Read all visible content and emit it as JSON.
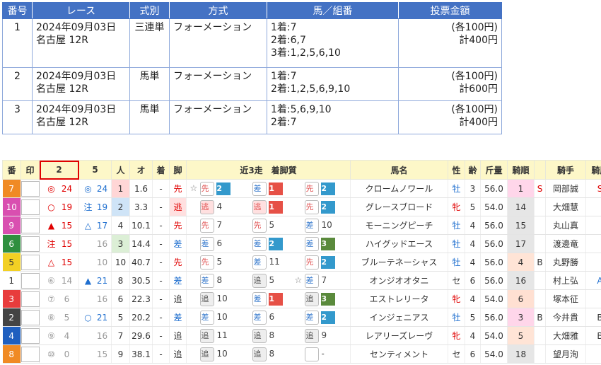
{
  "tickets": {
    "headers": [
      "番号",
      "レース",
      "式別",
      "方式",
      "馬／組番",
      "投票金額"
    ],
    "rows": [
      {
        "no": "1",
        "date": "2024年09月03日",
        "race": "名古屋 12R",
        "type": "三連単",
        "method": "フォーメーション",
        "combo": [
          "1着:7",
          "2着:6,7",
          "3着:1,2,5,6,10"
        ],
        "unit": "(各100円)",
        "total": "計400円"
      },
      {
        "no": "2",
        "date": "2024年09月03日",
        "race": "名古屋 12R",
        "type": "馬単",
        "method": "フォーメーション",
        "combo": [
          "1着:7",
          "2着:1,2,5,6,9,10"
        ],
        "unit": "(各100円)",
        "total": "計600円"
      },
      {
        "no": "3",
        "date": "2024年09月03日",
        "race": "名古屋 12R",
        "type": "馬単",
        "method": "フォーメーション",
        "combo": [
          "1着:5,6,9,10",
          "2着:7"
        ],
        "unit": "(各100円)",
        "total": "計400円"
      }
    ]
  },
  "horses": {
    "headers": [
      "番",
      "印",
      "2",
      "5",
      "人",
      "オ",
      "着",
      "脚",
      "近3走　着脚質",
      "馬名",
      "性",
      "齢",
      "斤量",
      "騎順",
      "",
      "騎手",
      "騎厩"
    ],
    "colors": {
      "1": "#ffffff",
      "2": "#444444",
      "3": "#e83c3c",
      "4": "#1f5fbf",
      "5": "#f2d024",
      "6": "#2f8f3f",
      "7": "#f08a24",
      "8": "#f08a24",
      "9": "#d94fb0",
      "10": "#d94fb0"
    },
    "rows": [
      {
        "num": "7",
        "pc": "#f08a24",
        "tc": "#fff",
        "m2": "◎",
        "m2c": "red",
        "v2": "24",
        "v2c": "red",
        "m5": "◎",
        "m5c": "blue",
        "v5": "24",
        "v5c": "blue",
        "pop": "1",
        "popbg": "#ffd6d6",
        "odds": "1.6",
        "fin": "-",
        "leg": "先",
        "legc": "red",
        "legbg": "#fff",
        "runs": [
          {
            "star": "☆",
            "style": "先",
            "cls": "sen",
            "pos": "2",
            "f": "f2"
          },
          {
            "star": "",
            "style": "差",
            "cls": "sa",
            "pos": "1",
            "f": "f1"
          },
          {
            "star": "",
            "style": "先",
            "cls": "sen",
            "pos": "2",
            "f": "f2"
          }
        ],
        "name": "クロームノワール",
        "sex": "牡",
        "sexc": "blue",
        "age": "3",
        "wt": "56.0",
        "kjun": "1",
        "kcls": "k1",
        "ex": "S",
        "exc": "red",
        "jockey": "岡部誠",
        "kyu": "S",
        "kyuc": "red"
      },
      {
        "num": "10",
        "pc": "#d94fb0",
        "tc": "#fff",
        "m2": "○",
        "m2c": "red",
        "v2": "19",
        "v2c": "red",
        "m5": "注",
        "m5c": "blue",
        "v5": "19",
        "v5c": "blue",
        "pop": "2",
        "popbg": "#cfe4f7",
        "odds": "3.3",
        "fin": "-",
        "leg": "逃",
        "legc": "red",
        "legbg": "#ffe0e0",
        "runs": [
          {
            "star": "",
            "style": "逃",
            "cls": "nige",
            "pos": "4",
            "f": ""
          },
          {
            "star": "",
            "style": "逃",
            "cls": "nige",
            "pos": "1",
            "f": "f1"
          },
          {
            "star": "",
            "style": "先",
            "cls": "sen",
            "pos": "2",
            "f": "f2"
          }
        ],
        "name": "グレースブロード",
        "sex": "牝",
        "sexc": "red",
        "age": "5",
        "wt": "54.0",
        "kjun": "14",
        "kcls": "",
        "ex": "",
        "exc": "",
        "jockey": "大畑慧",
        "kyu": "",
        "kyuc": ""
      },
      {
        "num": "9",
        "pc": "#d94fb0",
        "tc": "#fff",
        "m2": "▲",
        "m2c": "red",
        "v2": "15",
        "v2c": "red",
        "m5": "△",
        "m5c": "blue",
        "v5": "17",
        "v5c": "blue",
        "pop": "4",
        "popbg": "#fff",
        "odds": "10.1",
        "fin": "-",
        "leg": "先",
        "legc": "red",
        "legbg": "#fff",
        "runs": [
          {
            "star": "",
            "style": "先",
            "cls": "sen",
            "pos": "7",
            "f": ""
          },
          {
            "star": "",
            "style": "先",
            "cls": "sen",
            "pos": "5",
            "f": ""
          },
          {
            "star": "",
            "style": "差",
            "cls": "sa",
            "pos": "10",
            "f": ""
          }
        ],
        "name": "モーニングピーチ",
        "sex": "牡",
        "sexc": "blue",
        "age": "4",
        "wt": "56.0",
        "kjun": "15",
        "kcls": "",
        "ex": "",
        "exc": "",
        "jockey": "丸山真",
        "kyu": "",
        "kyuc": ""
      },
      {
        "num": "6",
        "pc": "#2f8f3f",
        "tc": "#fff",
        "m2": "注",
        "m2c": "red",
        "v2": "15",
        "v2c": "red",
        "m5": "",
        "m5c": "",
        "v5": "16",
        "v5c": "gray",
        "pop": "3",
        "popbg": "#dcefd6",
        "odds": "14.4",
        "fin": "-",
        "leg": "差",
        "legc": "blue",
        "legbg": "#fff",
        "runs": [
          {
            "star": "",
            "style": "差",
            "cls": "sa",
            "pos": "6",
            "f": ""
          },
          {
            "star": "",
            "style": "差",
            "cls": "sa",
            "pos": "2",
            "f": "f2"
          },
          {
            "star": "",
            "style": "差",
            "cls": "sa",
            "pos": "3",
            "f": "f3"
          }
        ],
        "name": "ハイグッドエース",
        "sex": "牡",
        "sexc": "blue",
        "age": "4",
        "wt": "56.0",
        "kjun": "17",
        "kcls": "",
        "ex": "",
        "exc": "",
        "jockey": "渡邊竜",
        "kyu": "",
        "kyuc": ""
      },
      {
        "num": "5",
        "pc": "#f2d024",
        "tc": "#333",
        "m2": "△",
        "m2c": "red",
        "v2": "15",
        "v2c": "red",
        "m5": "",
        "m5c": "",
        "v5": "10",
        "v5c": "gray",
        "pop": "10",
        "popbg": "#fff",
        "odds": "40.7",
        "fin": "-",
        "leg": "先",
        "legc": "red",
        "legbg": "#fff",
        "runs": [
          {
            "star": "",
            "style": "先",
            "cls": "sen",
            "pos": "5",
            "f": ""
          },
          {
            "star": "",
            "style": "差",
            "cls": "sa",
            "pos": "11",
            "f": ""
          },
          {
            "star": "",
            "style": "先",
            "cls": "sen",
            "pos": "2",
            "f": "f2"
          }
        ],
        "name": "ブルーテネーシャス",
        "sex": "牡",
        "sexc": "blue",
        "age": "4",
        "wt": "56.0",
        "kjun": "4",
        "kcls": "k2",
        "ex": "B",
        "exc": "",
        "jockey": "丸野勝",
        "kyu": "",
        "kyuc": ""
      },
      {
        "num": "1",
        "pc": "#ffffff",
        "tc": "#333",
        "m2": "⑥",
        "m2c": "gray",
        "v2": "14",
        "v2c": "gray",
        "m5": "▲",
        "m5c": "blue",
        "v5": "21",
        "v5c": "blue",
        "pop": "8",
        "popbg": "#fff",
        "odds": "30.5",
        "fin": "-",
        "leg": "差",
        "legc": "blue",
        "legbg": "#fff",
        "runs": [
          {
            "star": "",
            "style": "差",
            "cls": "sa",
            "pos": "8",
            "f": ""
          },
          {
            "star": "",
            "style": "追",
            "cls": "oi",
            "pos": "5",
            "f": ""
          },
          {
            "star": "☆",
            "style": "差",
            "cls": "sa",
            "pos": "7",
            "f": ""
          }
        ],
        "name": "オンジオオタニ",
        "sex": "セ",
        "sexc": "",
        "age": "6",
        "wt": "56.0",
        "kjun": "16",
        "kcls": "",
        "ex": "",
        "exc": "",
        "jockey": "村上弘",
        "kyu": "A",
        "kyuc": "blue"
      },
      {
        "num": "3",
        "pc": "#e83c3c",
        "tc": "#fff",
        "m2": "⑦",
        "m2c": "gray",
        "v2": "6",
        "v2c": "gray",
        "m5": "",
        "m5c": "",
        "v5": "16",
        "v5c": "gray",
        "pop": "6",
        "popbg": "#fff",
        "odds": "22.3",
        "fin": "-",
        "leg": "追",
        "legc": "",
        "legbg": "#fff",
        "runs": [
          {
            "star": "",
            "style": "追",
            "cls": "oi",
            "pos": "10",
            "f": ""
          },
          {
            "star": "",
            "style": "差",
            "cls": "sa",
            "pos": "1",
            "f": "f1"
          },
          {
            "star": "",
            "style": "追",
            "cls": "oi",
            "pos": "3",
            "f": "f3"
          }
        ],
        "name": "エストレリータ",
        "sex": "牝",
        "sexc": "red",
        "age": "4",
        "wt": "54.0",
        "kjun": "6",
        "kcls": "k3",
        "ex": "",
        "exc": "",
        "jockey": "塚本征",
        "kyu": "",
        "kyuc": ""
      },
      {
        "num": "2",
        "pc": "#444444",
        "tc": "#fff",
        "m2": "⑧",
        "m2c": "gray",
        "v2": "5",
        "v2c": "gray",
        "m5": "○",
        "m5c": "blue",
        "v5": "21",
        "v5c": "blue",
        "pop": "5",
        "popbg": "#fff",
        "odds": "20.2",
        "fin": "-",
        "leg": "差",
        "legc": "blue",
        "legbg": "#fff",
        "runs": [
          {
            "star": "",
            "style": "差",
            "cls": "sa",
            "pos": "10",
            "f": ""
          },
          {
            "star": "",
            "style": "差",
            "cls": "sa",
            "pos": "6",
            "f": ""
          },
          {
            "star": "",
            "style": "差",
            "cls": "sa",
            "pos": "2",
            "f": "f2"
          }
        ],
        "name": "インジェニアス",
        "sex": "牡",
        "sexc": "blue",
        "age": "5",
        "wt": "56.0",
        "kjun": "3",
        "kcls": "k1",
        "ex": "B",
        "exc": "",
        "jockey": "今井貴",
        "kyu": "B",
        "kyuc": ""
      },
      {
        "num": "4",
        "pc": "#1f5fbf",
        "tc": "#fff",
        "m2": "⑨",
        "m2c": "gray",
        "v2": "4",
        "v2c": "gray",
        "m5": "",
        "m5c": "",
        "v5": "16",
        "v5c": "gray",
        "pop": "7",
        "popbg": "#fff",
        "odds": "29.6",
        "fin": "-",
        "leg": "追",
        "legc": "",
        "legbg": "#fff",
        "runs": [
          {
            "star": "",
            "style": "追",
            "cls": "oi",
            "pos": "11",
            "f": ""
          },
          {
            "star": "",
            "style": "追",
            "cls": "oi",
            "pos": "8",
            "f": ""
          },
          {
            "star": "",
            "style": "追",
            "cls": "oi",
            "pos": "9",
            "f": ""
          }
        ],
        "name": "レアリーズレーヴ",
        "sex": "牝",
        "sexc": "red",
        "age": "4",
        "wt": "54.0",
        "kjun": "5",
        "kcls": "k2",
        "ex": "",
        "exc": "",
        "jockey": "大畑雅",
        "kyu": "B",
        "kyuc": ""
      },
      {
        "num": "8",
        "pc": "#f08a24",
        "tc": "#fff",
        "m2": "⑩",
        "m2c": "gray",
        "v2": "0",
        "v2c": "gray",
        "m5": "",
        "m5c": "",
        "v5": "15",
        "v5c": "gray",
        "pop": "9",
        "popbg": "#fff",
        "odds": "38.1",
        "fin": "-",
        "leg": "追",
        "legc": "",
        "legbg": "#fff",
        "runs": [
          {
            "star": "",
            "style": "追",
            "cls": "oi",
            "pos": "10",
            "f": ""
          },
          {
            "star": "",
            "style": "追",
            "cls": "oi",
            "pos": "8",
            "f": ""
          },
          {
            "star": "",
            "style": "",
            "cls": "blank",
            "pos": "-",
            "f": ""
          }
        ],
        "name": "センティメント",
        "sex": "セ",
        "sexc": "",
        "age": "6",
        "wt": "54.0",
        "kjun": "18",
        "kcls": "",
        "ex": "",
        "exc": "",
        "jockey": "望月洵",
        "kyu": "",
        "kyuc": ""
      }
    ]
  }
}
